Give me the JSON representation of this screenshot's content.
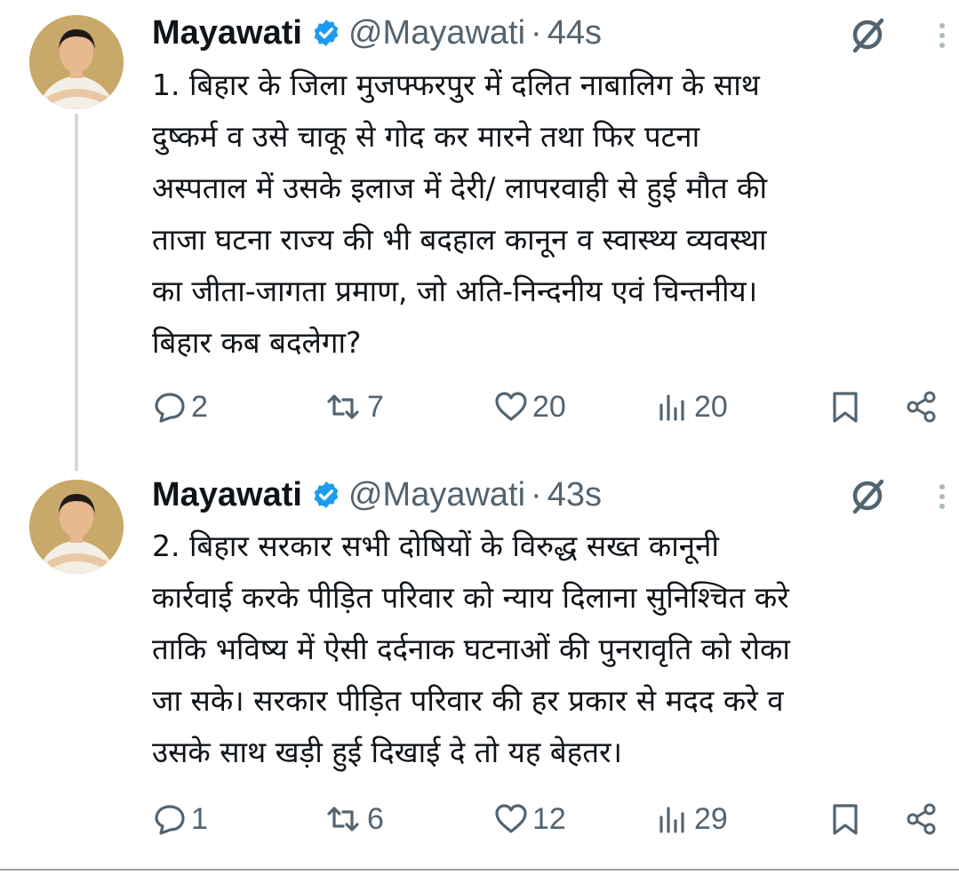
{
  "tweets": [
    {
      "name": "Mayawati",
      "handle": "@Mayawati",
      "separator": "·",
      "time": "44s",
      "lines": [
        "1. बिहार के जिला मुजफ्फरपुर में दलित नाबालिग के साथ",
        "दुष्कर्म व उसे चाकू से गोद कर मारने तथा फिर पटना",
        "अस्पताल में उसके इलाज में देरी/ लापरवाही से हुई मौत की",
        "ताजा घटना राज्य की भी बदहाल कानून व स्वास्थ्य व्यवस्था",
        "का जीता-जागता प्रमाण, जो अति-निन्दनीय एवं चिन्तनीय।",
        "बिहार कब बदलेगा?"
      ],
      "replies": "2",
      "reposts": "7",
      "likes": "20",
      "views": "20"
    },
    {
      "name": "Mayawati",
      "handle": "@Mayawati",
      "separator": "·",
      "time": "43s",
      "lines": [
        "2. बिहार सरकार सभी दोषियों के विरुद्ध सख्त कानूनी",
        "कार्रवाई करके पीड़ित परिवार को न्याय दिलाना सुनिश्चित करे",
        "ताकि भविष्य में ऐसी दर्दनाक घटनाओं की पुनरावृति को रोका",
        "जा सके। सरकार पीड़ित परिवार की हर प्रकार से मदद करे व",
        "उसके साथ खड़ी हुई दिखाई दे तो यह बेहतर।"
      ],
      "replies": "1",
      "reposts": "6",
      "likes": "12",
      "views": "29"
    }
  ],
  "colors": {
    "verified": "#1d9bf0",
    "secondary_text": "#536471",
    "primary_text": "#0f1419",
    "thread_line": "#cfd9de"
  },
  "icons": [
    "verified-badge-icon",
    "grok-icon",
    "more-icon",
    "reply-icon",
    "repost-icon",
    "like-icon",
    "views-icon",
    "bookmark-icon",
    "share-icon"
  ]
}
